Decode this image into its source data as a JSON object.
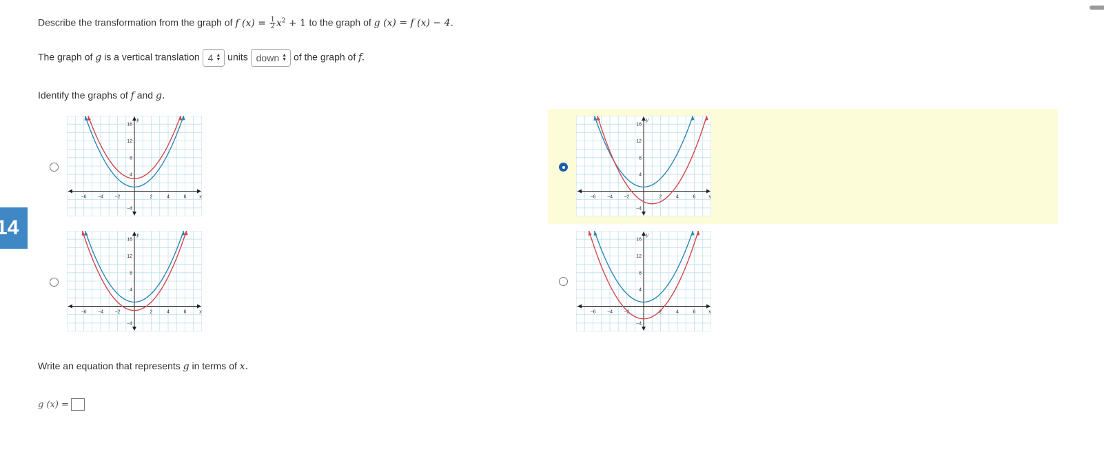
{
  "question": {
    "prompt_prefix": "Describe the transformation from the graph of",
    "f_expr": "f (x) =",
    "frac_num": "1",
    "frac_den": "2",
    "x2": "x",
    "exp": "2",
    "plus_one": "+ 1",
    "to_the_graph_of": "to the graph of",
    "g_expr": "g (x) = f (x) − 4."
  },
  "translation": {
    "prefix": "The graph of",
    "g": "g",
    "middle": "is a vertical translation",
    "amount": "4",
    "units": "units",
    "direction": "down",
    "suffix": "of the graph of",
    "f": "f."
  },
  "identify": {
    "prefix": "Identify the graphs of",
    "f": "f",
    "and": "and",
    "g": "g."
  },
  "graph_options": [
    {
      "selected": false
    },
    {
      "selected": true
    },
    {
      "selected": false
    },
    {
      "selected": false
    }
  ],
  "chart_data": [
    {
      "type": "line",
      "x_tick_labels": [
        "−6",
        "−4",
        "−2",
        "2",
        "4",
        "6"
      ],
      "y_tick_labels": [
        "16",
        "12",
        "8",
        "4",
        "−4"
      ],
      "xlabel": "x",
      "ylabel": "y",
      "xlim": [
        -8,
        8
      ],
      "ylim": [
        -6,
        18
      ],
      "grid": true,
      "series": [
        {
          "color": "#d2474b",
          "vertex": [
            0,
            3
          ],
          "a": 0.5
        },
        {
          "color": "#2e86b8",
          "vertex": [
            0,
            1
          ],
          "a": 0.5
        }
      ]
    },
    {
      "type": "line",
      "x_tick_labels": [
        "−6",
        "−4",
        "−2",
        "2",
        "4",
        "6"
      ],
      "y_tick_labels": [
        "16",
        "12",
        "8",
        "4",
        "−4"
      ],
      "xlabel": "x",
      "ylabel": "y",
      "xlim": [
        -8,
        8
      ],
      "ylim": [
        -6,
        18
      ],
      "grid": true,
      "series": [
        {
          "color": "#2e86b8",
          "vertex": [
            0,
            1
          ],
          "a": 0.5
        },
        {
          "color": "#d2474b",
          "vertex": [
            1,
            -3
          ],
          "a": 0.5
        }
      ]
    },
    {
      "type": "line",
      "x_tick_labels": [
        "−6",
        "−4",
        "−2",
        "2",
        "4",
        "6"
      ],
      "y_tick_labels": [
        "16",
        "12",
        "8",
        "4",
        "−4"
      ],
      "xlabel": "x",
      "ylabel": "y",
      "xlim": [
        -8,
        8
      ],
      "ylim": [
        -6,
        18
      ],
      "grid": true,
      "series": [
        {
          "color": "#2e86b8",
          "vertex": [
            0,
            1
          ],
          "a": 0.5
        },
        {
          "color": "#d2474b",
          "vertex": [
            0,
            -1
          ],
          "a": 0.5
        }
      ]
    },
    {
      "type": "line",
      "x_tick_labels": [
        "−6",
        "−4",
        "−2",
        "2",
        "4",
        "6"
      ],
      "y_tick_labels": [
        "16",
        "12",
        "8",
        "4",
        "−4"
      ],
      "xlabel": "x",
      "ylabel": "y",
      "xlim": [
        -8,
        8
      ],
      "ylim": [
        -6,
        18
      ],
      "grid": true,
      "series": [
        {
          "color": "#2e86b8",
          "vertex": [
            0,
            1
          ],
          "a": 0.5
        },
        {
          "color": "#d2474b",
          "vertex": [
            0,
            -3
          ],
          "a": 0.5
        }
      ]
    }
  ],
  "equation": {
    "prompt_prefix": "Write an equation that represents",
    "g": "g",
    "in_terms_of": "in terms of",
    "x": "x.",
    "answer_label": "g (x) =",
    "answer_value": ""
  },
  "side_tab": {
    "label": "14"
  }
}
